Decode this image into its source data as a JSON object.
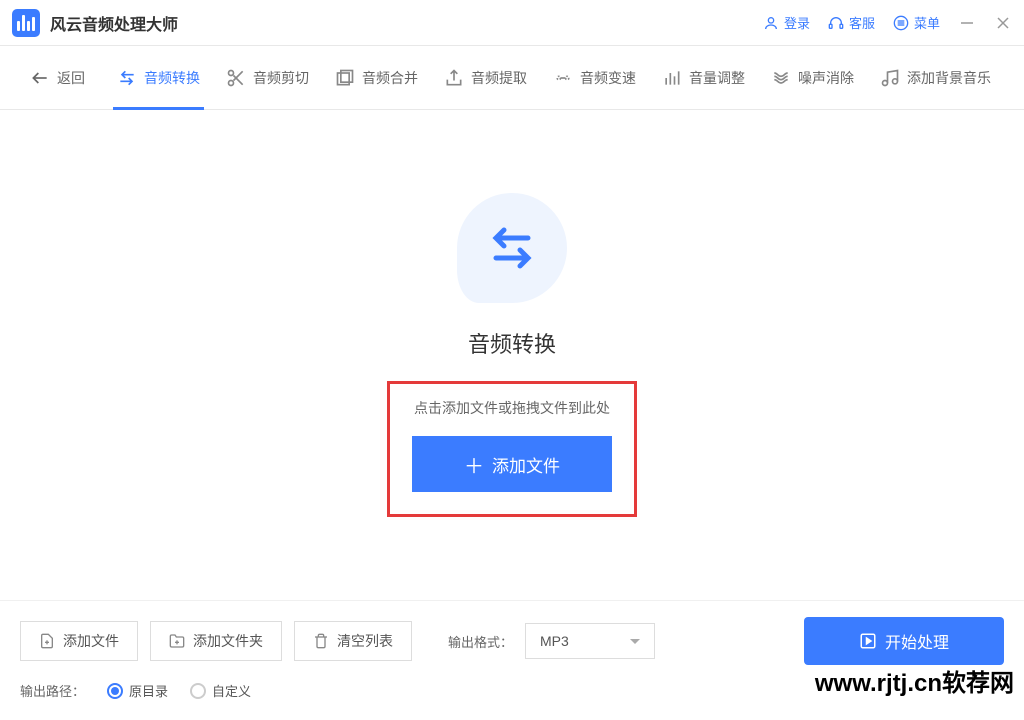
{
  "app": {
    "title": "风云音频处理大师"
  },
  "titlebar": {
    "login": "登录",
    "support": "客服",
    "menu": "菜单"
  },
  "nav": {
    "back": "返回",
    "items": [
      {
        "label": "音频转换",
        "icon": "swap"
      },
      {
        "label": "音频剪切",
        "icon": "scissors"
      },
      {
        "label": "音频合并",
        "icon": "merge"
      },
      {
        "label": "音频提取",
        "icon": "extract"
      },
      {
        "label": "音频变速",
        "icon": "speed"
      },
      {
        "label": "音量调整",
        "icon": "volume"
      },
      {
        "label": "噪声消除",
        "icon": "noise"
      },
      {
        "label": "添加背景音乐",
        "icon": "music"
      }
    ]
  },
  "main": {
    "title": "音频转换",
    "hint": "点击添加文件或拖拽文件到此处",
    "add_btn": "添加文件"
  },
  "footer": {
    "add_file": "添加文件",
    "add_folder": "添加文件夹",
    "clear": "清空列表",
    "format_label": "输出格式：",
    "format_value": "MP3",
    "start": "开始处理",
    "output_label": "输出路径：",
    "radio_source": "原目录",
    "radio_custom": "自定义"
  },
  "watermark": "www.rjtj.cn软荐网"
}
